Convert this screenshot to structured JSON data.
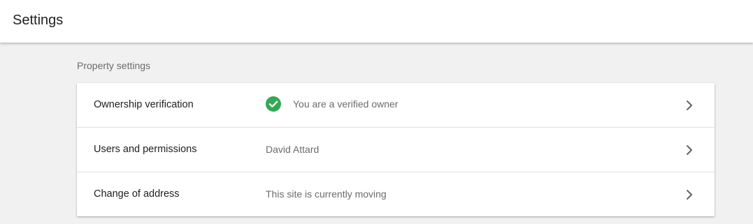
{
  "header": {
    "title": "Settings"
  },
  "section": {
    "title": "Property settings"
  },
  "rows": [
    {
      "label": "Ownership verification",
      "value": "You are a verified owner",
      "icon": "check-circle-icon"
    },
    {
      "label": "Users and permissions",
      "value": "David Attard"
    },
    {
      "label": "Change of address",
      "value": "This site is currently moving"
    }
  ],
  "colors": {
    "verified": "#34a853",
    "chevron": "#5f6368"
  }
}
